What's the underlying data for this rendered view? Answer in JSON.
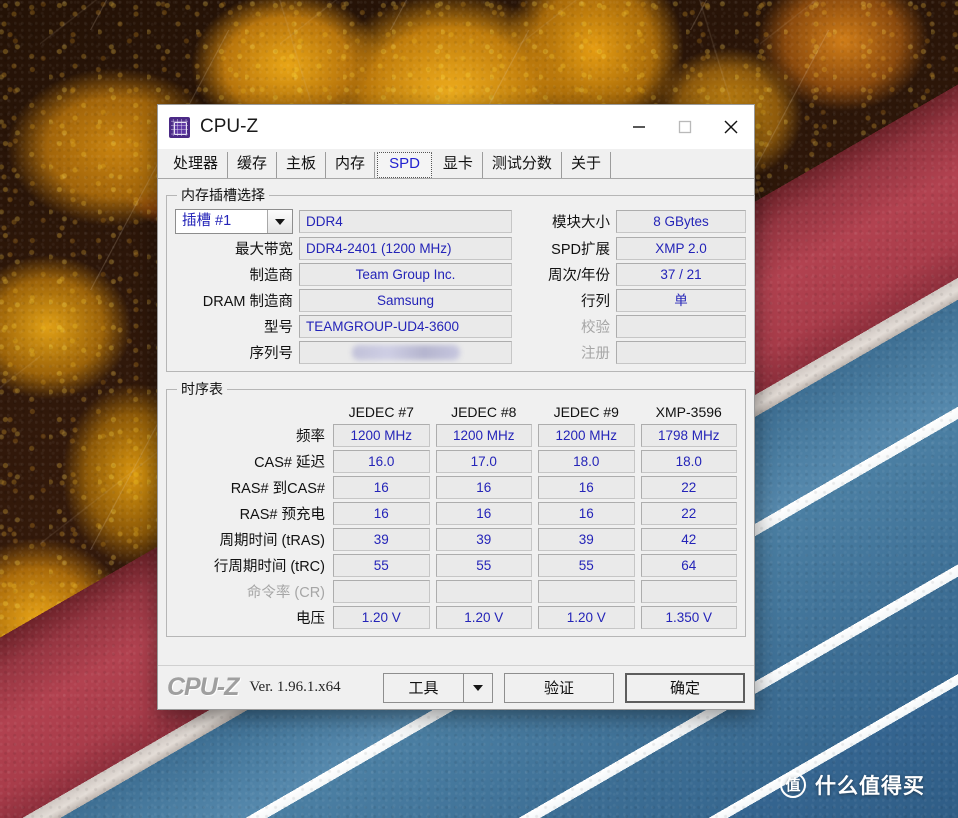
{
  "window": {
    "title": "CPU-Z",
    "icon": "cpu-chip-icon",
    "controls": {
      "minimize": "–",
      "maximize": "□",
      "close": "✕"
    }
  },
  "tabs": [
    {
      "label": "处理器",
      "selected": false
    },
    {
      "label": "缓存",
      "selected": false
    },
    {
      "label": "主板",
      "selected": false
    },
    {
      "label": "内存",
      "selected": false
    },
    {
      "label": "SPD",
      "selected": true
    },
    {
      "label": "显卡",
      "selected": false
    },
    {
      "label": "测试分数",
      "selected": false
    },
    {
      "label": "关于",
      "selected": false
    }
  ],
  "slot_group": {
    "legend": "内存插槽选择",
    "slot_selected": "插槽 #1",
    "memory_type": "DDR4",
    "left_rows": [
      {
        "label": "最大带宽",
        "value": "DDR4-2401 (1200 MHz)"
      },
      {
        "label": "制造商",
        "value": "Team Group Inc."
      },
      {
        "label": "DRAM 制造商",
        "value": "Samsung"
      },
      {
        "label": "型号",
        "value": "TEAMGROUP-UD4-3600"
      },
      {
        "label": "序列号",
        "value": "",
        "redacted": true
      }
    ],
    "right_rows": [
      {
        "label": "模块大小",
        "value": "8 GBytes",
        "dim": false
      },
      {
        "label": "SPD扩展",
        "value": "XMP 2.0",
        "dim": false
      },
      {
        "label": "周次/年份",
        "value": "37 / 21",
        "dim": false
      },
      {
        "label": "行列",
        "value": "单",
        "dim": false
      },
      {
        "label": "校验",
        "value": "",
        "dim": true
      },
      {
        "label": "注册",
        "value": "",
        "dim": true
      }
    ]
  },
  "timings_group": {
    "legend": "时序表",
    "columns": [
      "JEDEC #7",
      "JEDEC #8",
      "JEDEC #9",
      "XMP-3596"
    ],
    "rows": [
      {
        "label": "频率",
        "dim": false,
        "values": [
          "1200 MHz",
          "1200 MHz",
          "1200 MHz",
          "1798 MHz"
        ]
      },
      {
        "label": "CAS# 延迟",
        "dim": false,
        "values": [
          "16.0",
          "17.0",
          "18.0",
          "18.0"
        ]
      },
      {
        "label": "RAS# 到CAS#",
        "dim": false,
        "values": [
          "16",
          "16",
          "16",
          "22"
        ]
      },
      {
        "label": "RAS# 预充电",
        "dim": false,
        "values": [
          "16",
          "16",
          "16",
          "22"
        ]
      },
      {
        "label": "周期时间 (tRAS)",
        "dim": false,
        "values": [
          "39",
          "39",
          "39",
          "42"
        ]
      },
      {
        "label": "行周期时间 (tRC)",
        "dim": false,
        "values": [
          "55",
          "55",
          "55",
          "64"
        ]
      },
      {
        "label": "命令率 (CR)",
        "dim": true,
        "values": [
          "",
          "",
          "",
          ""
        ]
      },
      {
        "label": "电压",
        "dim": false,
        "values": [
          "1.20 V",
          "1.20 V",
          "1.20 V",
          "1.350 V"
        ]
      }
    ]
  },
  "footer": {
    "brand": "CPU-Z",
    "version": "Ver. 1.96.1.x64",
    "tools_label": "工具",
    "tools_arrow": "▼",
    "validate_label": "验证",
    "ok_label": "确定"
  },
  "watermark": {
    "badge": "值",
    "text": "什么值得买"
  },
  "colors": {
    "value_blue": "#2424b8",
    "tab_selected": "#2020d0",
    "window_bg": "#f0f0f0",
    "field_bg": "#eaeaea",
    "brand_gray": "#9f9f9f"
  }
}
